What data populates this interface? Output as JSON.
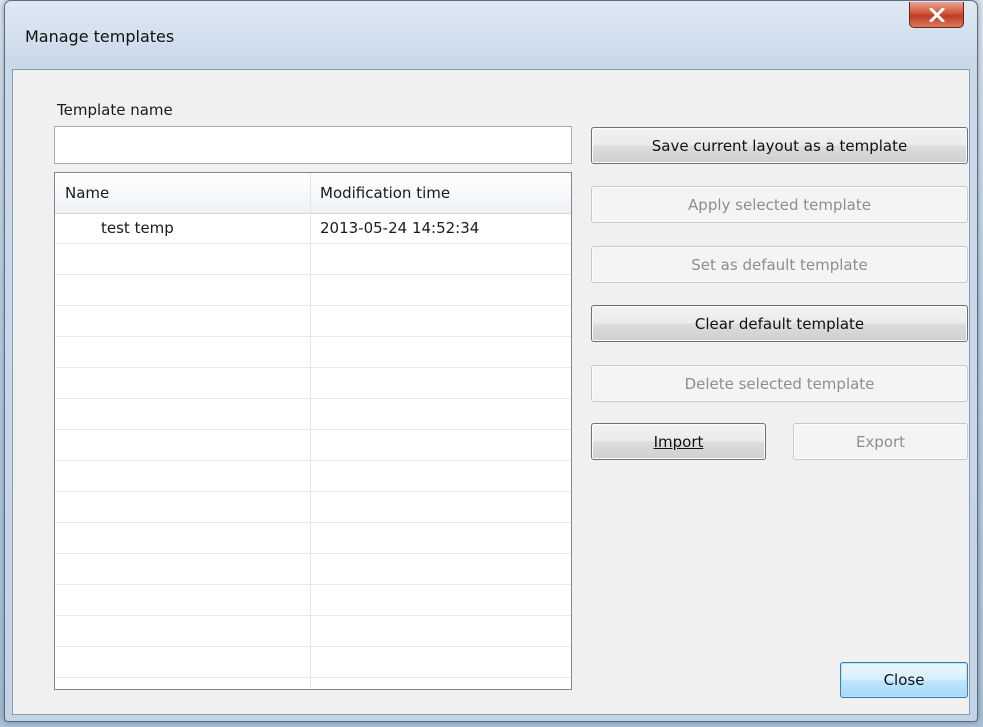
{
  "window": {
    "title": "Manage templates",
    "close_icon": "close-icon"
  },
  "form": {
    "template_name_label": "Template name",
    "template_name_value": "",
    "template_name_placeholder": ""
  },
  "list": {
    "columns": [
      "Name",
      "Modification time"
    ],
    "rows": [
      {
        "name": "test temp",
        "modified": "2013-05-24 14:52:34"
      }
    ],
    "empty_rows": 15
  },
  "buttons": {
    "save_layout": {
      "label": "Save current layout as a template",
      "enabled": true
    },
    "apply": {
      "label": "Apply selected template",
      "enabled": false
    },
    "set_default": {
      "label": "Set as default template",
      "enabled": false
    },
    "clear_default": {
      "label": "Clear default template",
      "enabled": true
    },
    "delete": {
      "label": "Delete selected template",
      "enabled": false
    },
    "import": {
      "label": "Import",
      "enabled": true
    },
    "export": {
      "label": "Export",
      "enabled": false
    },
    "close": {
      "label": "Close",
      "enabled": true
    }
  },
  "colors": {
    "close_button_red": "#c73b24",
    "dialog_face": "#f0f0f0",
    "focus_blue": "#3c7fb1"
  }
}
